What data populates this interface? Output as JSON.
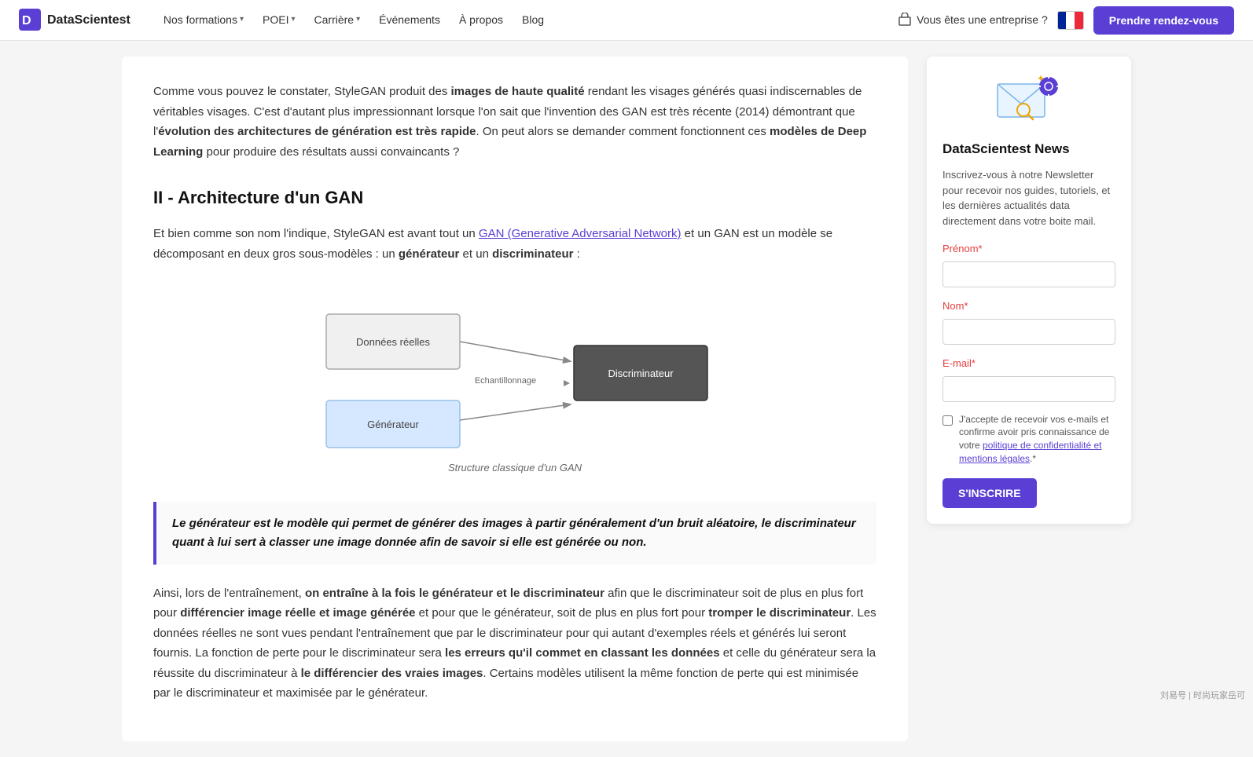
{
  "navbar": {
    "logo_text": "DataScientest",
    "nav_items": [
      {
        "label": "Nos formations",
        "has_chevron": true
      },
      {
        "label": "POEI",
        "has_chevron": true
      },
      {
        "label": "Carrière",
        "has_chevron": true
      },
      {
        "label": "Événements",
        "has_chevron": false
      },
      {
        "label": "À propos",
        "has_chevron": false
      },
      {
        "label": "Blog",
        "has_chevron": false
      }
    ],
    "enterprise_label": "Vous êtes une entreprise ?",
    "cta_label": "Prendre rendez-vous"
  },
  "article": {
    "intro_paragraph": "Comme vous pouvez le constater, StyleGAN produit des ",
    "intro_bold1": "images de haute qualité",
    "intro_mid1": " rendant les visages générés quasi indiscernables de véritables visages. C'est d'autant plus impressionnant lorsque l'on sait que l'invention des GAN est très récente (2014) démontrant que l'",
    "intro_bold2": "évolution des architectures de génération est très rapide",
    "intro_mid2": ". On peut alors se demander comment fonctionnent ces ",
    "intro_bold3": "modèles de Deep Learning",
    "intro_end": " pour produire des résultats aussi convaincants ?",
    "section_title": "II - Architecture d'un GAN",
    "section_p1_start": "Et bien comme son nom l'indique, StyleGAN est avant tout un ",
    "section_p1_link": "GAN (Generative Adversarial Network)",
    "section_p1_mid": " et un GAN est un modèle se décomposant en deux gros sous-modèles : un ",
    "section_p1_bold1": "générateur",
    "section_p1_and": " et un ",
    "section_p1_bold2": "discriminateur",
    "section_p1_end": " :",
    "diagram_caption": "Structure classique d'un GAN",
    "diagram_labels": {
      "donnees": "Données réelles",
      "generateur": "Générateur",
      "echantillonnage": "Echantillonnage",
      "discriminateur": "Discriminateur"
    },
    "highlight_quote": "Le générateur est le modèle qui permet de générer des images à partir généralement d'un bruit aléatoire, le discriminateur quant à lui sert à classer une image donnée afin de savoir si elle est générée ou non.",
    "bottom_p1_start": "Ainsi, lors de l'entraînement, ",
    "bottom_p1_bold1": "on entraîne à la fois le générateur et le discriminateur",
    "bottom_p1_mid1": " afin que le discriminateur soit de plus en plus fort pour ",
    "bottom_p1_bold2": "différencier image réelle et image générée",
    "bottom_p1_mid2": " et pour que le générateur, soit de plus en plus fort pour ",
    "bottom_p1_bold3": "tromper le discriminateur",
    "bottom_p1_mid3": ". Les données réelles ne sont vues pendant l'entraînement que par le discriminateur pour qui autant d'exemples réels et générés lui seront fournis. La fonction de perte pour le discriminateur sera ",
    "bottom_p1_bold4": "les erreurs qu'il commet en classant les données",
    "bottom_p1_mid4": " et celle du générateur sera la réussite du discriminateur à ",
    "bottom_p1_bold5": "le différencier des vraies images",
    "bottom_p1_end": ". Certains modèles utilisent la même fonction de perte qui est minimisée par le discriminateur et maximisée par le générateur."
  },
  "sidebar": {
    "news_title": "DataScientest News",
    "news_desc": "Inscrivez-vous à notre Newsletter pour recevoir nos guides, tutoriels, et les dernières actualités data directement dans votre boite mail.",
    "form": {
      "prenom_label": "Prénom",
      "prenom_required": "*",
      "nom_label": "Nom",
      "nom_required": "*",
      "email_label": "E-mail",
      "email_required": "*",
      "checkbox_text": "J'accepte de recevoir vos e-mails et confirme avoir pris connaissance de votre politique de confidentialité et mentions légales.",
      "checkbox_required": "*",
      "subscribe_label": "S'INSCRIRE"
    }
  },
  "watermark": "刘易号 | 时尚玩家岳可"
}
